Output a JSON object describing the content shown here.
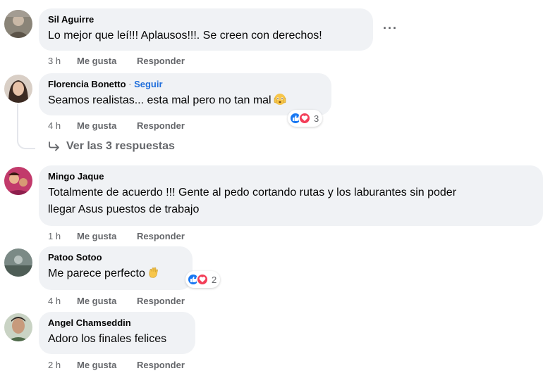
{
  "comments": [
    {
      "author": "Sil Aguirre",
      "text": "Lo mejor que leí!!! Aplausos!!!. Se creen con derechos!",
      "time": "3 h",
      "like_label": "Me gusta",
      "reply_label": "Responder",
      "more_icon": "more-options-icon"
    },
    {
      "author": "Florencia Bonetto",
      "follow_label": "Seguir",
      "text": "Seamos realistas... esta mal pero no tan mal",
      "emoji": "flushed-face",
      "time": "4 h",
      "like_label": "Me gusta",
      "reply_label": "Responder",
      "reaction_count": "3",
      "view_replies_label": "Ver las 3 respuestas"
    },
    {
      "author": "Mingo Jaque",
      "text_line1": "Totalmente de acuerdo !!! Gente al pedo cortando rutas y los laburantes sin poder",
      "text_line2": "llegar Asus puestos de trabajo",
      "time": "1 h",
      "like_label": "Me gusta",
      "reply_label": "Responder"
    },
    {
      "author": "Patoo Sotoo",
      "text": "Me parece perfecto",
      "emoji": "waving-hand",
      "time": "4 h",
      "like_label": "Me gusta",
      "reply_label": "Responder",
      "reaction_count": "2"
    },
    {
      "author": "Angel Chamseddin",
      "text": "Adoro los finales felices",
      "time": "2 h",
      "like_label": "Me gusta",
      "reply_label": "Responder"
    }
  ],
  "colors": {
    "bubble": "#f0f2f5",
    "secondary_text": "#65676b",
    "follow_blue": "#216fdb",
    "like_blue": "#1877f2",
    "love_red": "#f33e58"
  }
}
